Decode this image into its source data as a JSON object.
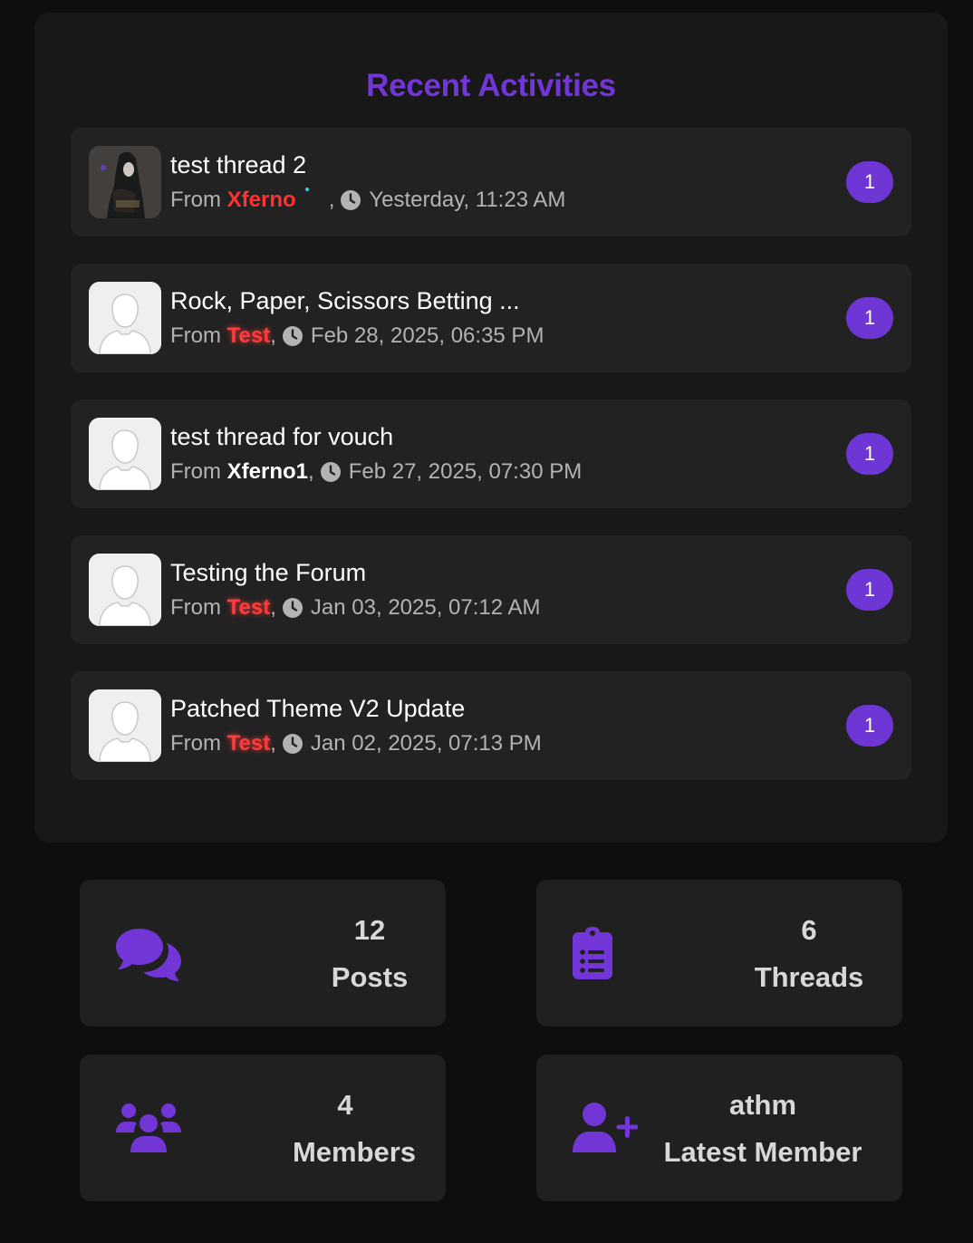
{
  "recent": {
    "title": "Recent Activities",
    "from_label": "From",
    "items": [
      {
        "title": "test thread 2",
        "user": "Xferno",
        "time": "Yesterday, 11:23 AM",
        "count": "1"
      },
      {
        "title": "Rock, Paper, Scissors Betting ...",
        "user": "Test",
        "time": "Feb 28, 2025, 06:35 PM",
        "count": "1"
      },
      {
        "title": "test thread for vouch",
        "user": "Xferno1",
        "time": "Feb 27, 2025, 07:30 PM",
        "count": "1"
      },
      {
        "title": "Testing the Forum",
        "user": "Test",
        "time": "Jan 03, 2025, 07:12 AM",
        "count": "1"
      },
      {
        "title": "Patched Theme V2 Update",
        "user": "Test",
        "time": "Jan 02, 2025, 07:13 PM",
        "count": "1"
      }
    ]
  },
  "stats": {
    "posts": {
      "value": "12",
      "label": "Posts",
      "icon": "comments-icon"
    },
    "threads": {
      "value": "6",
      "label": "Threads",
      "icon": "clipboard-list-icon"
    },
    "members": {
      "value": "4",
      "label": "Members",
      "icon": "users-icon"
    },
    "latest": {
      "value": "athm",
      "label": "Latest Member",
      "icon": "user-plus-icon"
    }
  },
  "colors": {
    "accent": "#6f36d6",
    "username_red": "#ff3131",
    "background": "#0e0e0e",
    "card": "#222222"
  }
}
